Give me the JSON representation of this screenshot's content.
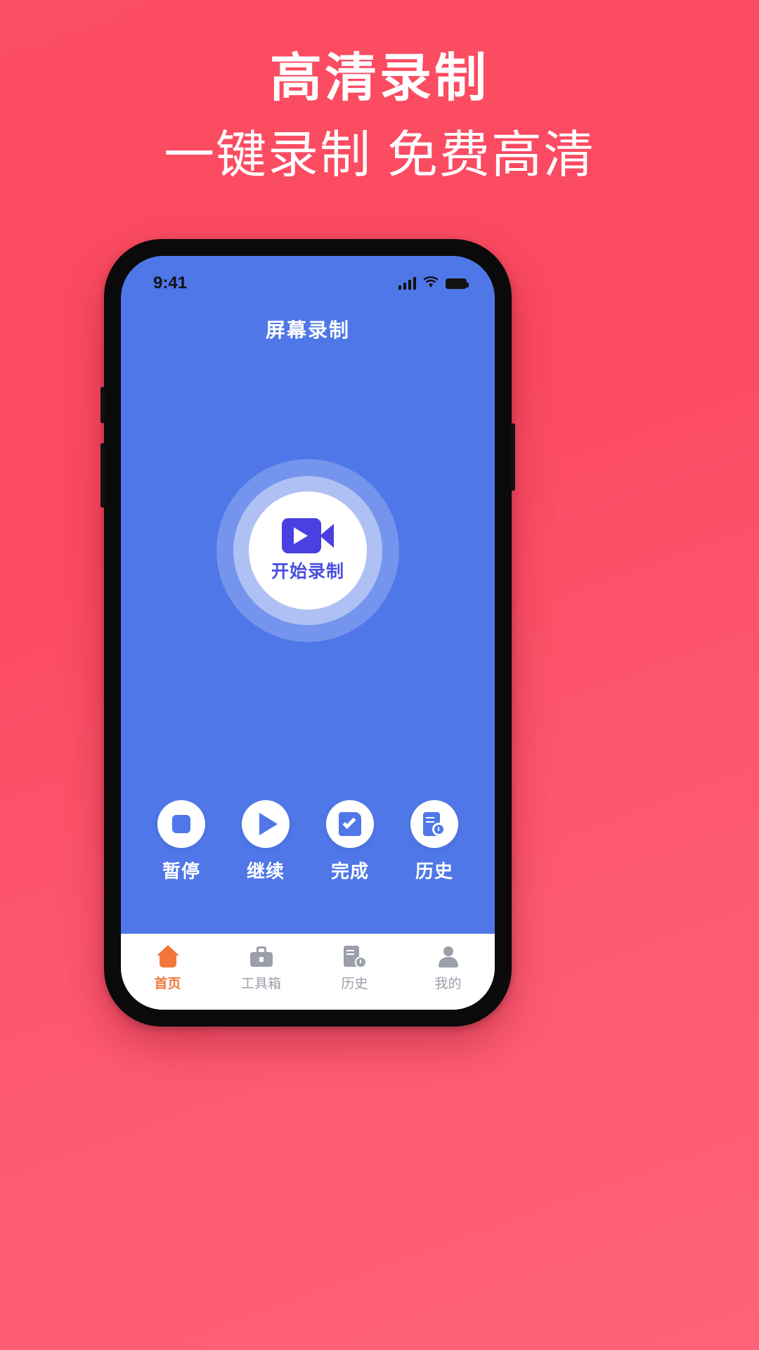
{
  "promo": {
    "title": "高清录制",
    "subtitle": "一键录制 免费高清"
  },
  "colors": {
    "background_start": "#fb4d63",
    "background_end": "#fe6278",
    "app_blue": "#4f77e8",
    "icon_purple": "#4a3fe0",
    "tab_active": "#f0763c",
    "tab_inactive": "#9b9fa8"
  },
  "phone": {
    "status_bar": {
      "time": "9:41",
      "signal_icon": "signal-bars-icon",
      "wifi_icon": "wifi-icon",
      "battery_icon": "battery-full-icon"
    },
    "app_title": "屏幕录制",
    "record_button": {
      "label": "开始录制",
      "icon": "video-camera-icon"
    },
    "actions": [
      {
        "label": "暂停",
        "icon": "stop-square-icon"
      },
      {
        "label": "继续",
        "icon": "play-triangle-icon"
      },
      {
        "label": "完成",
        "icon": "document-check-icon"
      },
      {
        "label": "历史",
        "icon": "document-clock-icon"
      }
    ],
    "tabs": [
      {
        "label": "首页",
        "icon": "home-icon",
        "active": true
      },
      {
        "label": "工具箱",
        "icon": "toolbox-icon",
        "active": false
      },
      {
        "label": "历史",
        "icon": "document-clock-icon",
        "active": false
      },
      {
        "label": "我的",
        "icon": "person-icon",
        "active": false
      }
    ]
  }
}
